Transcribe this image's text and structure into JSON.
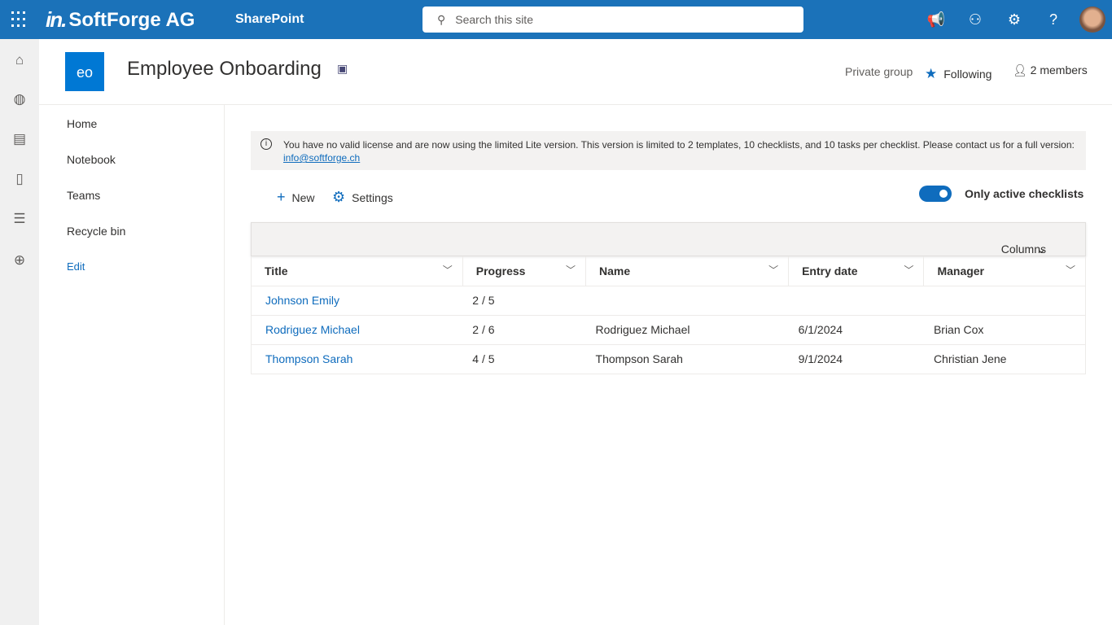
{
  "topbar": {
    "brand": "SoftForge AG",
    "app": "SharePoint",
    "search_placeholder": "Search this site"
  },
  "site": {
    "initials": "eo",
    "title": "Employee Onboarding",
    "privacy": "Private group",
    "follow": "Following",
    "members": "2 members"
  },
  "nav": [
    {
      "label": "Home"
    },
    {
      "label": "Notebook"
    },
    {
      "label": "Teams"
    },
    {
      "label": "Recycle bin"
    },
    {
      "label": "Edit"
    }
  ],
  "banner": {
    "text": "You have no valid license and are now using the limited Lite version. This version is limited to 2 templates, 10 checklists, and 10 tasks per checklist. Please contact us for a full version:",
    "email": "info@softforge.ch"
  },
  "toolbar": {
    "new": "New",
    "settings": "Settings",
    "toggle_label": "Only active checklists",
    "toggle_on": true,
    "columns": "Columns"
  },
  "table": {
    "headers": [
      "Title",
      "Progress",
      "Name",
      "Entry date",
      "Manager"
    ],
    "rows": [
      [
        "Johnson Emily",
        "2 / 5",
        "",
        "",
        ""
      ],
      [
        "Rodriguez Michael",
        "2 / 6",
        "Rodriguez Michael",
        "6/1/2024",
        "Brian Cox"
      ],
      [
        "Thompson Sarah",
        "4 / 5",
        "Thompson Sarah",
        "9/1/2024",
        "Christian Jene"
      ]
    ]
  }
}
